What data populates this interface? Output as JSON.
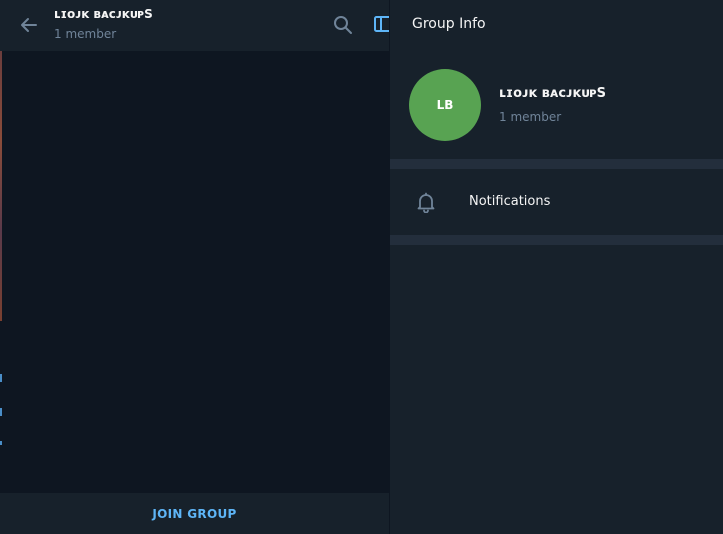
{
  "chat": {
    "title": "ʟɪᴏᴊᴋ ʙᴀᴄᴊᴋᴜᴘS",
    "subtitle": "1 member",
    "join_label": "JOIN GROUP"
  },
  "info_panel": {
    "title": "Group Info",
    "avatar_initials": "LB",
    "group_name": "ʟɪᴏᴊᴋ ʙᴀᴄᴊᴋᴜᴘS",
    "member_count": "1 member",
    "notifications_label": "Notifications"
  },
  "icons": {
    "back": "back-arrow-icon",
    "search": "search-icon",
    "sidebar_toggle": "sidebar-toggle-icon",
    "bell": "bell-icon"
  },
  "colors": {
    "accent": "#5eb5f7",
    "avatar": "#58a352",
    "header_bg": "#17212b",
    "chat_bg": "#0e1621",
    "divider": "#232e3c",
    "secondary_text": "#708499"
  }
}
